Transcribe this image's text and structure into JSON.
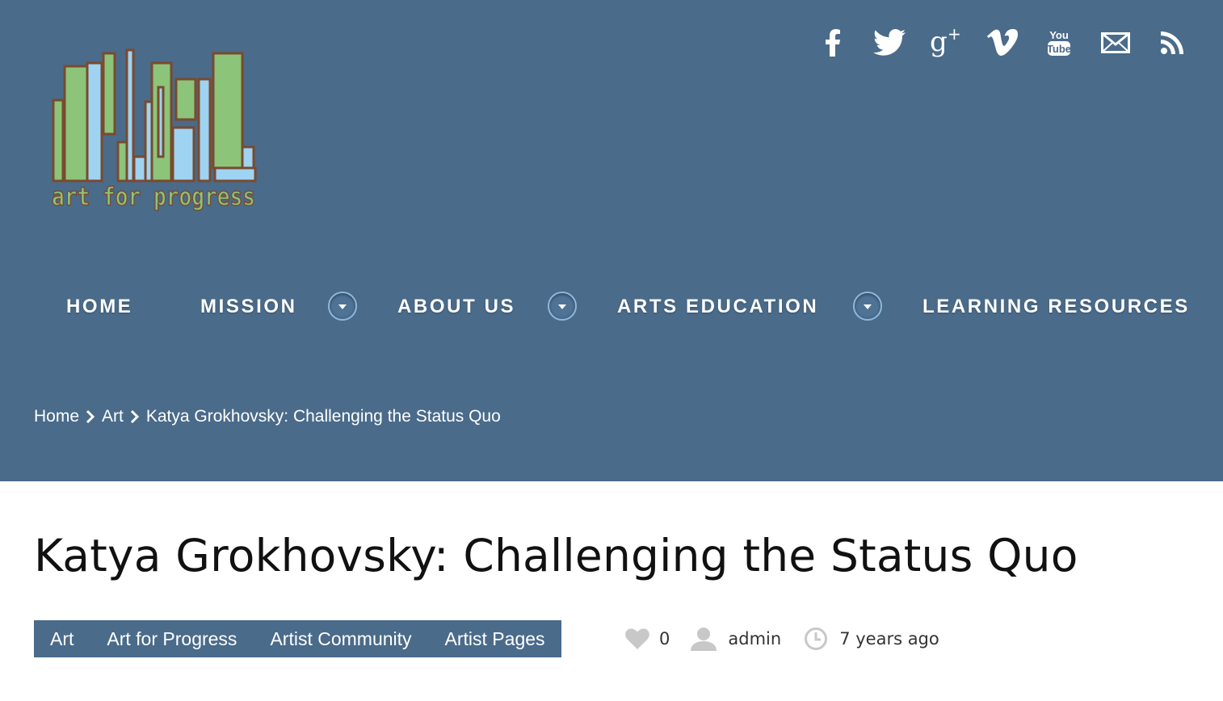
{
  "site": {
    "logo_text": "art for progress"
  },
  "social": [
    {
      "icon": "facebook-icon"
    },
    {
      "icon": "twitter-icon"
    },
    {
      "icon": "google-plus-icon"
    },
    {
      "icon": "vimeo-icon"
    },
    {
      "icon": "youtube-icon",
      "text_top": "You",
      "text_bottom": "Tube"
    },
    {
      "icon": "email-icon"
    },
    {
      "icon": "rss-icon"
    }
  ],
  "nav": {
    "items": [
      {
        "label": "HOME",
        "has_dropdown": false
      },
      {
        "label": "MISSION",
        "has_dropdown": true
      },
      {
        "label": "ABOUT US",
        "has_dropdown": true
      },
      {
        "label": "ARTS EDUCATION",
        "has_dropdown": true
      },
      {
        "label": "LEARNING RESOURCES",
        "has_dropdown": false
      }
    ]
  },
  "breadcrumb": {
    "items": [
      "Home",
      "Art",
      "Katya Grokhovsky: Challenging the Status Quo"
    ]
  },
  "post": {
    "title": "Katya Grokhovsky: Challenging the Status Quo",
    "categories": [
      "Art",
      "Art for Progress",
      "Artist Community",
      "Artist Pages"
    ],
    "likes": "0",
    "author": "admin",
    "date": "7 years ago"
  },
  "colors": {
    "header_bg": "#4a6b8a",
    "logo_green": "#8cc47a",
    "logo_blue": "#9fd3f2",
    "logo_outline": "#7a4a2e",
    "meta_icon": "#c8c8c8"
  }
}
